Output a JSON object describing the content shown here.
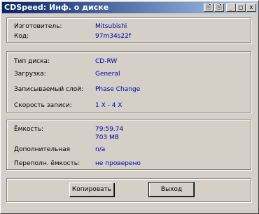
{
  "window": {
    "title": "CDSpeed: Инф. о диске",
    "title_buttons": [
      "🗎",
      "🗎",
      "_",
      "□",
      "x"
    ]
  },
  "group1": {
    "rows": [
      {
        "label": "Изготовитель:",
        "value": "Mitsubishi"
      },
      {
        "label": "Код:",
        "value": "97m34s22f"
      }
    ]
  },
  "group2": {
    "rows": [
      {
        "label": "Тип диска:",
        "value": "CD-RW"
      },
      {
        "label": "Загрузка:",
        "value": "General"
      },
      {
        "label": "Записываемый слой:",
        "value": "Phase Change"
      },
      {
        "label": "Скорость записи:",
        "value": "1 X - 4 X"
      }
    ]
  },
  "group3": {
    "capacity_label": "Ёмкость:",
    "capacity_time": "79:59.74",
    "capacity_size": "703 MB",
    "additional_label": "Дополнительная",
    "additional_value": "n/a",
    "overburn_label": "Переполн. ёмкость:",
    "overburn_value": "не проверено"
  },
  "buttons": {
    "copy": "Копировать",
    "exit": "Выход"
  }
}
